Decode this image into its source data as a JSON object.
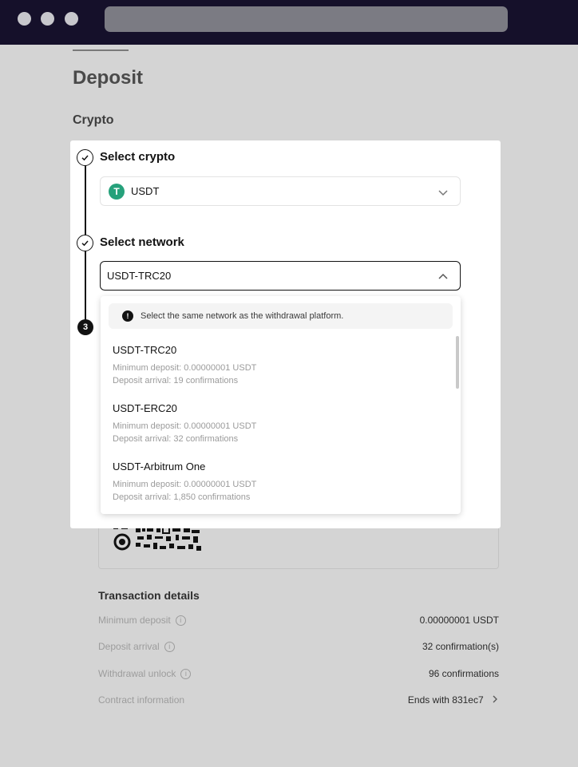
{
  "page": {
    "title": "Deposit",
    "section_label": "Crypto"
  },
  "steps": {
    "step1": {
      "label": "Select crypto",
      "value": "USDT",
      "coin_icon": "tether-logo-icon",
      "coin_color": "#26a17b"
    },
    "step2": {
      "label": "Select network",
      "value": "USDT-TRC20"
    },
    "step3": {
      "number": "3"
    }
  },
  "network_dropdown": {
    "notice": "Select the same network as the withdrawal platform.",
    "options": [
      {
        "name": "USDT-TRC20",
        "min_deposit": "Minimum deposit: 0.00000001 USDT",
        "arrival": "Deposit arrival: 19 confirmations"
      },
      {
        "name": "USDT-ERC20",
        "min_deposit": "Minimum deposit: 0.00000001 USDT",
        "arrival": "Deposit arrival: 32 confirmations"
      },
      {
        "name": "USDT-Arbitrum One",
        "min_deposit": "Minimum deposit: 0.00000001 USDT",
        "arrival": "Deposit arrival: 1,850 confirmations"
      }
    ]
  },
  "transaction_details": {
    "title": "Transaction details",
    "rows": [
      {
        "label": "Minimum deposit",
        "value": "0.00000001 USDT"
      },
      {
        "label": "Deposit arrival",
        "value": "32 confirmation(s)"
      },
      {
        "label": "Withdrawal unlock",
        "value": "96 confirmations"
      },
      {
        "label": "Contract information",
        "value": "Ends with 831ec7"
      }
    ]
  },
  "icons": {
    "check": "check-icon",
    "chevron_down": "chevron-down-icon",
    "chevron_up": "chevron-up-icon",
    "info": "info-icon",
    "chevron_right": "chevron-right-icon"
  },
  "colors": {
    "overlay_bg": "#d4d4d4",
    "topbar": "#15102a",
    "accent_dark": "#121212"
  }
}
